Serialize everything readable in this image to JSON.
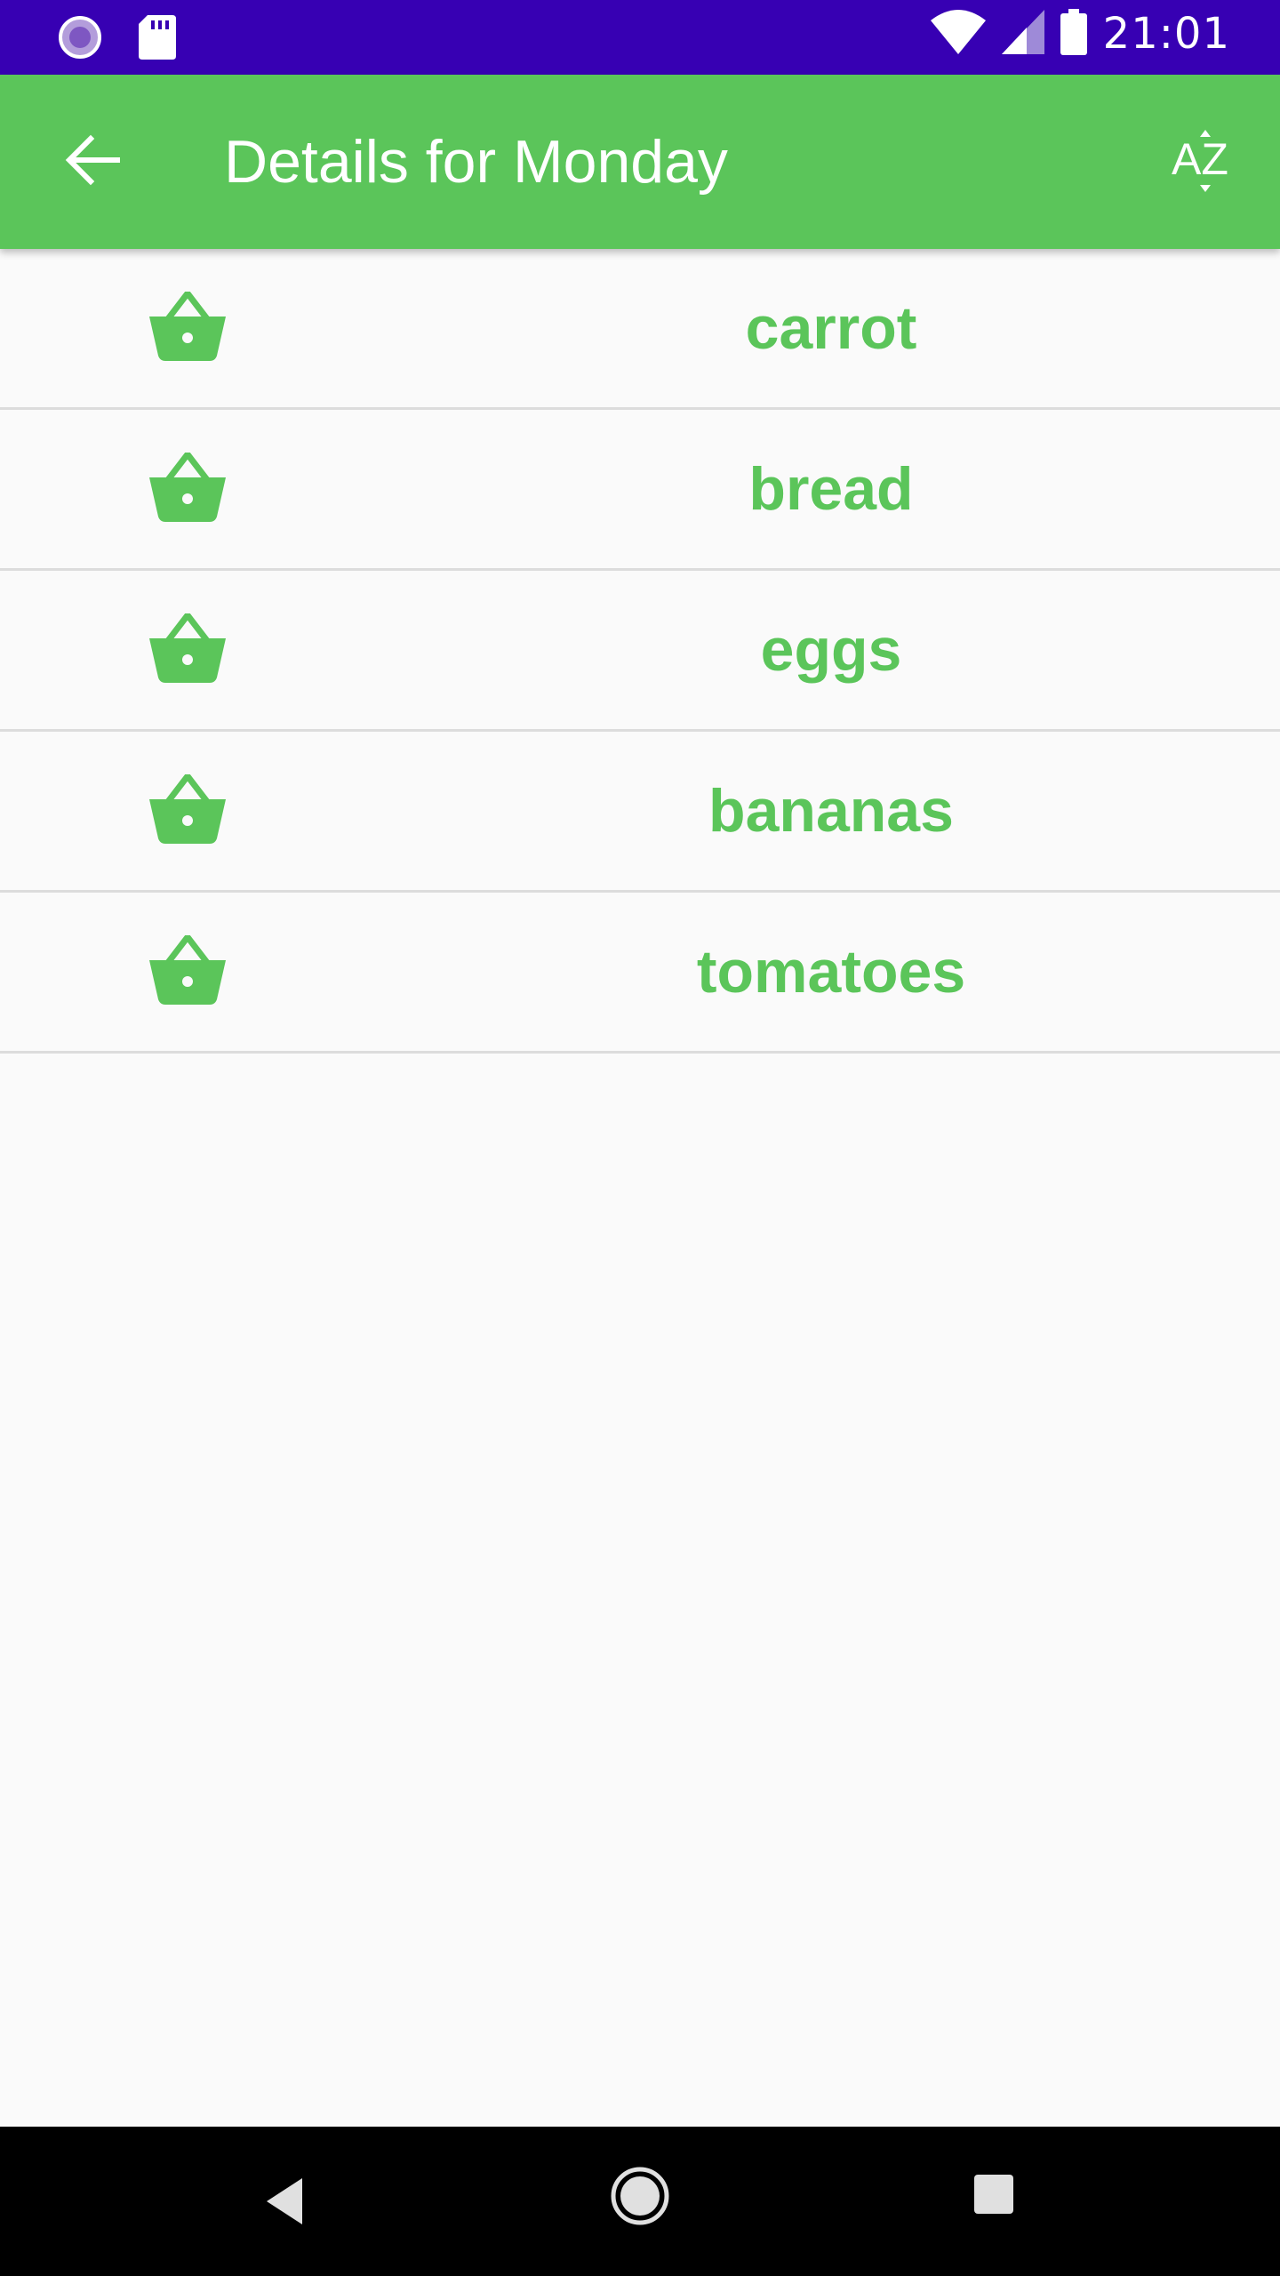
{
  "status_bar": {
    "time": "21:01",
    "icons": [
      "sync-icon",
      "sd-card-icon",
      "wifi-icon",
      "signal-icon",
      "battery-icon"
    ]
  },
  "app_bar": {
    "title": "Details for Monday",
    "back_icon": "arrow-back-icon",
    "sort_icon": "sort-az-icon",
    "sort_icon_text": "AZ"
  },
  "items": [
    {
      "label": "carrot",
      "icon": "basket-icon"
    },
    {
      "label": "bread",
      "icon": "basket-icon"
    },
    {
      "label": "eggs",
      "icon": "basket-icon"
    },
    {
      "label": "bananas",
      "icon": "basket-icon"
    },
    {
      "label": "tomatoes",
      "icon": "basket-icon"
    }
  ],
  "nav_bar": {
    "icons": [
      "nav-back-icon",
      "nav-home-icon",
      "nav-recents-icon"
    ]
  },
  "colors": {
    "status_bar": "#3700b3",
    "app_bar": "#5bc55a",
    "accent_text": "#5bc55a",
    "background": "#fafafa",
    "divider": "#dcdcdc",
    "nav_bar": "#000000"
  }
}
